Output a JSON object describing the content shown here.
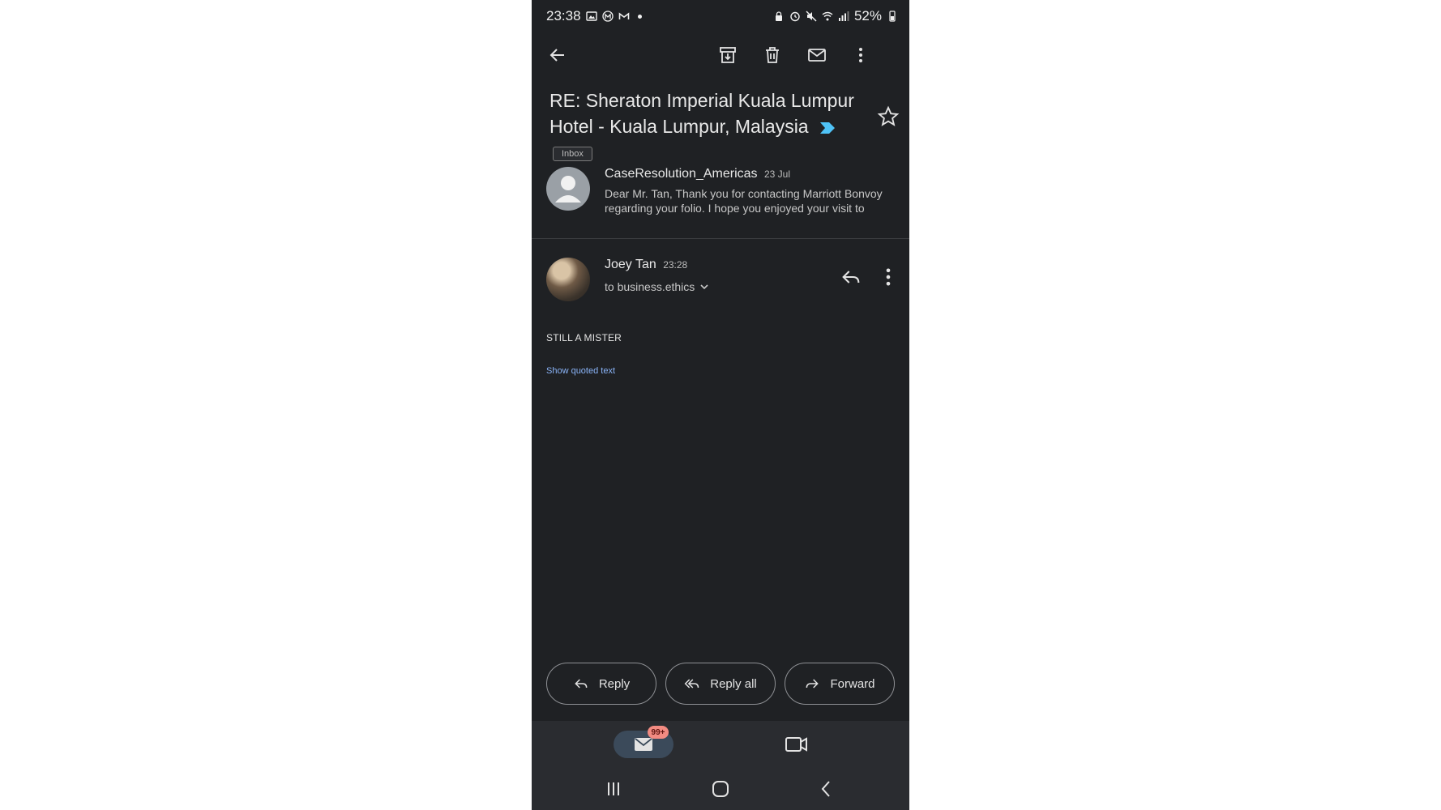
{
  "status_bar": {
    "time": "23:38",
    "battery": "52%"
  },
  "toolbar": {
    "icons": [
      "back-arrow-icon",
      "archive-icon",
      "delete-icon",
      "mark-unread-icon",
      "more-vert-icon"
    ]
  },
  "email": {
    "subject": "RE: Sheraton Imperial Kuala Lumpur Hotel - Kuala Lumpur, Malaysia",
    "label": "Inbox"
  },
  "messages": [
    {
      "sender": "CaseResolution_Americas",
      "date": "23 Jul",
      "snippet": "Dear Mr. Tan, Thank you for contacting Marriott Bonvoy regarding your folio. I hope you enjoyed your visit to"
    },
    {
      "sender": "Joey Tan",
      "time": "23:28",
      "to": "to business.ethics",
      "body": "STILL A MISTER",
      "show_quoted": "Show quoted text"
    }
  ],
  "actions": {
    "reply": "Reply",
    "reply_all": "Reply all",
    "forward": "Forward"
  },
  "bottom_nav": {
    "mail_badge": "99+"
  },
  "colors": {
    "background": "#1f2124",
    "link": "#8ab4f8",
    "badge": "#f28b82",
    "importance": "#4fc3f7"
  }
}
